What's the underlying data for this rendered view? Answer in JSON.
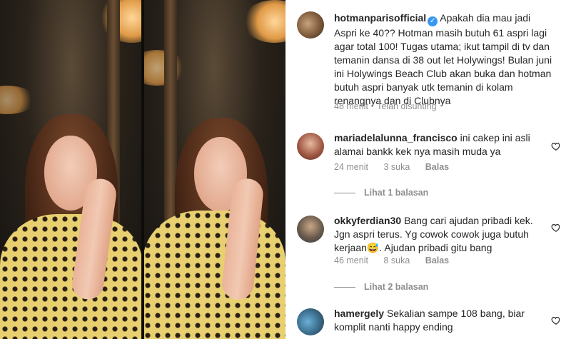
{
  "post": {
    "username": "hotmanparisofficial",
    "verified_mark": "✓",
    "caption": "Apakah dia mau jadi Aspri ke 40?? Hotman masih butuh 61 aspri lagi agar total 100! Tugas utama; ikut tampil di tv dan temanin dansa di 38 out let Holywings! Bulan juni ini Holywings Beach Club akan buka dan hotman butuh aspri banyak utk temanin di kolam renangnya dan di Clubnya",
    "time": "48 menit",
    "separator": "·",
    "edited": "Telah disunting"
  },
  "comments": [
    {
      "username": "mariadelalunna_francisco",
      "text": "ini cakep ini asli alamai bankk kek nya masih muda ya",
      "time": "24 menit",
      "likes": "3 suka",
      "reply_label": "Balas",
      "view_replies": "Lihat 1 balasan"
    },
    {
      "username": "okkyferdian30",
      "text": "Bang cari ajudan pribadi kek. Jgn aspri terus. Yg cowok cowok juga butuh kerjaan😅. Ajudan pribadi gitu bang",
      "time": "46 menit",
      "likes": "8 suka",
      "reply_label": "Balas",
      "view_replies": "Lihat 2 balasan"
    },
    {
      "username": "hamergely",
      "text": "Sekalian sampe 108 bang, biar komplit nanti happy ending"
    }
  ],
  "icons": {
    "heart": "heart-icon"
  }
}
